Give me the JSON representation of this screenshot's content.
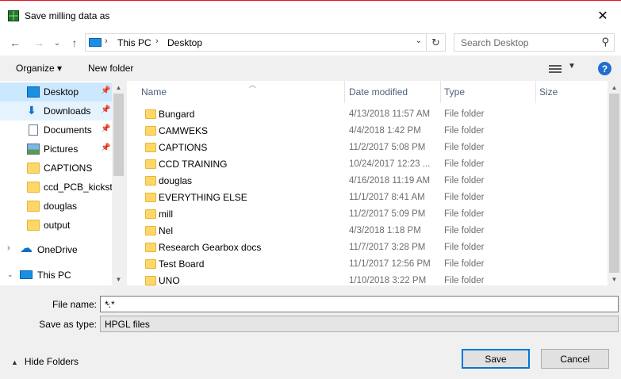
{
  "window": {
    "title": "Save milling data as",
    "close_glyph": "✕"
  },
  "nav": {
    "back": "←",
    "forward": "→",
    "recent": "⌄",
    "up": "↑",
    "breadcrumb": [
      "This PC",
      "Desktop"
    ],
    "search_placeholder": "Search Desktop"
  },
  "toolbar": {
    "organize": "Organize ▾",
    "new_folder": "New folder",
    "help": "?"
  },
  "sidebar": {
    "items": [
      {
        "label": "Desktop",
        "icon": "desktop-icon",
        "pinned": true,
        "state": "selected"
      },
      {
        "label": "Downloads",
        "icon": "download-icon",
        "pinned": true,
        "state": "hover"
      },
      {
        "label": "Documents",
        "icon": "documents-icon",
        "pinned": true
      },
      {
        "label": "Pictures",
        "icon": "pictures-icon",
        "pinned": true
      },
      {
        "label": "CAPTIONS",
        "icon": "folder-icon"
      },
      {
        "label": "ccd_PCB_kicksta",
        "icon": "folder-icon"
      },
      {
        "label": "douglas",
        "icon": "folder-icon"
      },
      {
        "label": "output",
        "icon": "folder-icon"
      },
      {
        "label": "OneDrive",
        "icon": "cloud-icon",
        "expander": ">"
      },
      {
        "label": "This PC",
        "icon": "computer-icon",
        "expander": "v"
      }
    ]
  },
  "files": {
    "columns": [
      "Name",
      "Date modified",
      "Type",
      "Size"
    ],
    "rows": [
      {
        "name": "Bungard",
        "date": "4/13/2018 11:57 AM",
        "type": "File folder"
      },
      {
        "name": "CAMWEKS",
        "date": "4/4/2018 1:42 PM",
        "type": "File folder"
      },
      {
        "name": "CAPTIONS",
        "date": "11/2/2017 5:08 PM",
        "type": "File folder"
      },
      {
        "name": "CCD TRAINING",
        "date": "10/24/2017 12:23 ...",
        "type": "File folder"
      },
      {
        "name": "douglas",
        "date": "4/16/2018 11:19 AM",
        "type": "File folder"
      },
      {
        "name": "EVERYTHING ELSE",
        "date": "11/1/2017 8:41 AM",
        "type": "File folder"
      },
      {
        "name": "mill",
        "date": "11/2/2017 5:09 PM",
        "type": "File folder"
      },
      {
        "name": "Nel",
        "date": "4/3/2018 1:18 PM",
        "type": "File folder"
      },
      {
        "name": "Research Gearbox docs",
        "date": "11/7/2017 3:28 PM",
        "type": "File folder"
      },
      {
        "name": "Test Board",
        "date": "11/1/2017 12:56 PM",
        "type": "File folder"
      },
      {
        "name": "UNO",
        "date": "1/10/2018 3:22 PM",
        "type": "File folder"
      }
    ]
  },
  "form": {
    "file_name_label": "File name:",
    "file_name_value": "*.*",
    "save_type_label": "Save as type:",
    "save_type_value": "HPGL files",
    "hide_folders": "Hide Folders",
    "save": "Save",
    "cancel": "Cancel"
  },
  "colors": {
    "selection": "#cce8ff",
    "hover": "#e5f3ff",
    "accent": "#0078d7",
    "folder": "#ffd766"
  }
}
